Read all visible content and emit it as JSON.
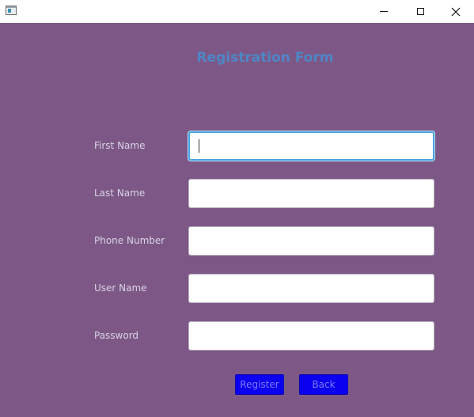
{
  "window": {
    "controls": {
      "minimize_icon": "minimize-icon",
      "maximize_icon": "maximize-icon",
      "close_icon": "close-icon"
    }
  },
  "form": {
    "title": "Registration Form",
    "title_color": "#4f86c6",
    "background_color": "#7d5886",
    "fields": [
      {
        "label": "First Name",
        "value": "",
        "focused": true
      },
      {
        "label": "Last Name",
        "value": ""
      },
      {
        "label": "Phone Number",
        "value": ""
      },
      {
        "label": "User Name",
        "value": ""
      },
      {
        "label": "Password",
        "value": ""
      }
    ],
    "buttons": {
      "register": "Register",
      "back": "Back",
      "color": "#0a00ef"
    }
  }
}
